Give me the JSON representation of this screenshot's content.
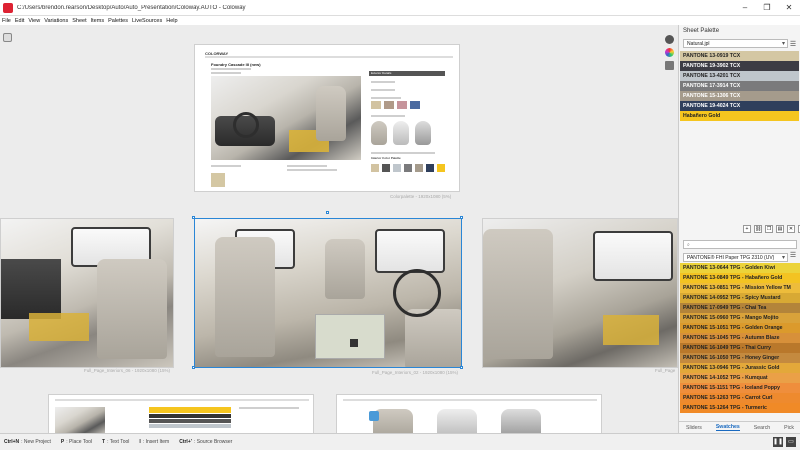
{
  "window": {
    "title": "C:/Users/brendon.rearson/Desktop/Auto/Auto_Presentation/Coloway.AUTO - Coloway",
    "buttons": [
      "–",
      "❐",
      "✕"
    ]
  },
  "menu": [
    "File",
    "Edit",
    "View",
    "Variations",
    "Sheet",
    "Items",
    "Palettes",
    "LiveSources",
    "Help"
  ],
  "canvas": {
    "top_page": {
      "brand": "COLORWAY",
      "heading": "Foundry Cascade III (new)",
      "caption": "Colorpalette - 1920x1080 (5%)",
      "sections": [
        "Exterior Details",
        "Interior Color Palette"
      ]
    },
    "left_caption": "Full_Page_Interiors_06 - 1920x1080 (15%)",
    "center_caption": "Full_Page_Interiors_02 - 1920x1080 (15%)",
    "right_caption": "Full_Page"
  },
  "panel": {
    "title": "Sheet Palette",
    "palette_dropdown": "Natural.jpl",
    "sheet_colors": [
      {
        "label": "PANTONE 13-0919 TCX",
        "bg": "#d4c7a3",
        "fg": "#222222"
      },
      {
        "label": "PANTONE 19-3902 TCX",
        "bg": "#3c3c44",
        "fg": "#ffffff"
      },
      {
        "label": "PANTONE 13-4201 TCX",
        "bg": "#bfc6cc",
        "fg": "#222222"
      },
      {
        "label": "PANTONE 17-3914 TCX",
        "bg": "#7a7a7c",
        "fg": "#ffffff"
      },
      {
        "label": "PANTONE 15-1306 TCX",
        "bg": "#a59b8c",
        "fg": "#ffffff"
      },
      {
        "label": "PANTONE 19-4024 TCX",
        "bg": "#2f3f5c",
        "fg": "#ffffff"
      },
      {
        "label": "Habañero Gold",
        "bg": "#f5c51f",
        "fg": "#222222"
      }
    ],
    "library_search": "PANTONE® FHI Paper TPG 2310 (UV)",
    "library_colors": [
      {
        "label": "PANTONE 13-0644 TPG - Golden Kiwi",
        "bg": "#ecd33a",
        "fg": "#222222"
      },
      {
        "label": "PANTONE 13-0849 TPG - Habañero Gold",
        "bg": "#f3c322",
        "fg": "#222222"
      },
      {
        "label": "PANTONE 13-0851 TPG - Mission Yellow TM",
        "bg": "#edbc3b",
        "fg": "#222222"
      },
      {
        "label": "PANTONE 14-0952 TPG - Spicy Mustard",
        "bg": "#d8a934",
        "fg": "#222222"
      },
      {
        "label": "PANTONE 17-0949 TPG - Chai Tea",
        "bg": "#b3843a",
        "fg": "#222222"
      },
      {
        "label": "PANTONE 15-0960 TPG - Mango Mojito",
        "bg": "#d9a23a",
        "fg": "#222222"
      },
      {
        "label": "PANTONE 15-1051 TPG - Golden Orange",
        "bg": "#db9a2c",
        "fg": "#222222"
      },
      {
        "label": "PANTONE 15-1045 TPG - Autumn Blaze",
        "bg": "#d7903a",
        "fg": "#222222"
      },
      {
        "label": "PANTONE 16-1049 TPG - Thai Curry",
        "bg": "#b9782b",
        "fg": "#222222"
      },
      {
        "label": "PANTONE 16-1050 TPG - Honey Ginger",
        "bg": "#c48a3f",
        "fg": "#222222"
      },
      {
        "label": "PANTONE 13-0946 TPG - Jurassic Gold",
        "bg": "#e3a83a",
        "fg": "#222222"
      },
      {
        "label": "PANTONE 14-1052 TPG - Kumquat",
        "bg": "#eaa047",
        "fg": "#222222"
      },
      {
        "label": "PANTONE 15-1151 TPG - Iceland Poppy",
        "bg": "#ef8e3c",
        "fg": "#222222"
      },
      {
        "label": "PANTONE 15-1263 TPG - Carrot Curl",
        "bg": "#ee8a2e",
        "fg": "#222222"
      },
      {
        "label": "PANTONE 15-1264 TPG - Turmeric",
        "bg": "#f08a27",
        "fg": "#222222"
      }
    ],
    "tabs": [
      "Sliders",
      "Swatches",
      "Search",
      "Pick"
    ],
    "active_tab": "Swatches"
  },
  "statusbar": [
    {
      "key": "Ctrl+N",
      "desc": ": New Project"
    },
    {
      "key": "P",
      "desc": ": Place Tool"
    },
    {
      "key": "T",
      "desc": ": Text Tool"
    },
    {
      "key": "I",
      "desc": ": Insert Item"
    },
    {
      "key": "Ctrl+'",
      "desc": ": Source Browser"
    }
  ]
}
